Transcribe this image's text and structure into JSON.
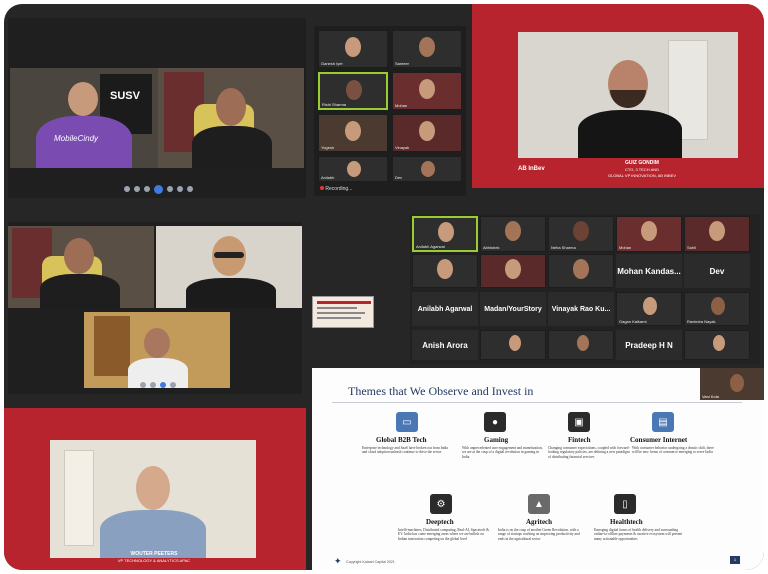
{
  "colors": {
    "frame": "#262626",
    "accent_red": "#b8242d",
    "slide_title": "#243a64"
  },
  "top_left_call": {
    "toolbar_icons": [
      "mic-icon",
      "video-icon",
      "share-icon",
      "participants-icon",
      "chat-icon",
      "record-icon",
      "reactions-icon"
    ],
    "poster_text": "SUSV",
    "shirt_text": "MobileCindy"
  },
  "gallery_top": {
    "tiles": [
      "Ganesh Iyer",
      "Sameer",
      "Rishi Sharma",
      "Mohan",
      "Yogesh",
      "Vinayak",
      "Anilabh",
      "Dev"
    ],
    "recording_label": "Recording..."
  },
  "speaker_top_right": {
    "name": "GUIZ GONDIM",
    "title_line1": "CTO, 3 TECH AND",
    "title_line2": "GLOBAL VP INNOVATION, AB INBEV",
    "logo": "AB InBev"
  },
  "gallery_middle": {
    "row1": [
      "Anilabh Agarwal",
      "Abhishek",
      "Neha Sharma",
      "Mohan",
      "Sahil"
    ],
    "row2_names": {
      "mohan": "Mohan Kandas...",
      "dev": "Dev"
    },
    "row3_names": {
      "anilabh": "Anilabh Agarwal",
      "madan": "Madan/YourStory",
      "vinayak": "Vinayak Rao Ku..."
    },
    "row3_tiles": [
      "Gagan Kalkarni",
      "Ravindra Nayak"
    ],
    "row4_names": {
      "anish": "Anish Arora",
      "pradeep": "Pradeep H N"
    }
  },
  "speaker_bottom_left": {
    "name": "WOUTER PEETERS",
    "title": "VP TECHNOLOGY & ANALYTICS APAC"
  },
  "slide": {
    "title": "Themes that We Observe and Invest in",
    "themes": [
      {
        "icon": "monitor-icon",
        "title": "Global B2B Tech",
        "desc": "Enterprise technology and SaaS have broken out from India and cloud adoption unleash continue to drive the sector"
      },
      {
        "icon": "gamepad-icon",
        "title": "Gaming",
        "desc": "With unprecedented user engagement and monetization, we are at the cusp of a digital revolution in gaming in India"
      },
      {
        "icon": "chip-icon",
        "title": "Fintech",
        "desc": "Changing consumer expectations, coupled with forward-looking regulatory policies, are defining a new paradigm of distributing financial services"
      },
      {
        "icon": "browser-icon",
        "title": "Consumer Internet",
        "desc": "With consumer behavior undergoing a drastic shift, there will be new forms of commerce emerging to serve India"
      },
      {
        "icon": "robot-arm-icon",
        "title": "Deeptech",
        "desc": "Intelli-machines, Distributed computing, Real-AI, Spacetech & EV. India has come emerging areas where we are bullish on Indian innovation competing on the global level"
      },
      {
        "icon": "tractor-icon",
        "title": "Agritech",
        "desc": "India is on the cusp of another Green Revolution, with a range of startups working on improving productivity and ends in the agricultural sector"
      },
      {
        "icon": "phone-health-icon",
        "title": "Healthtech",
        "desc": "Emerging digital forms of health delivery and surrounding online-to-offline payments & curative ecosystem will present many actionable opportunities"
      }
    ],
    "footer": "Copyright Kalaari Capital 2021",
    "page_number": "1",
    "speaker_tile_caption": "Vani Kola"
  }
}
